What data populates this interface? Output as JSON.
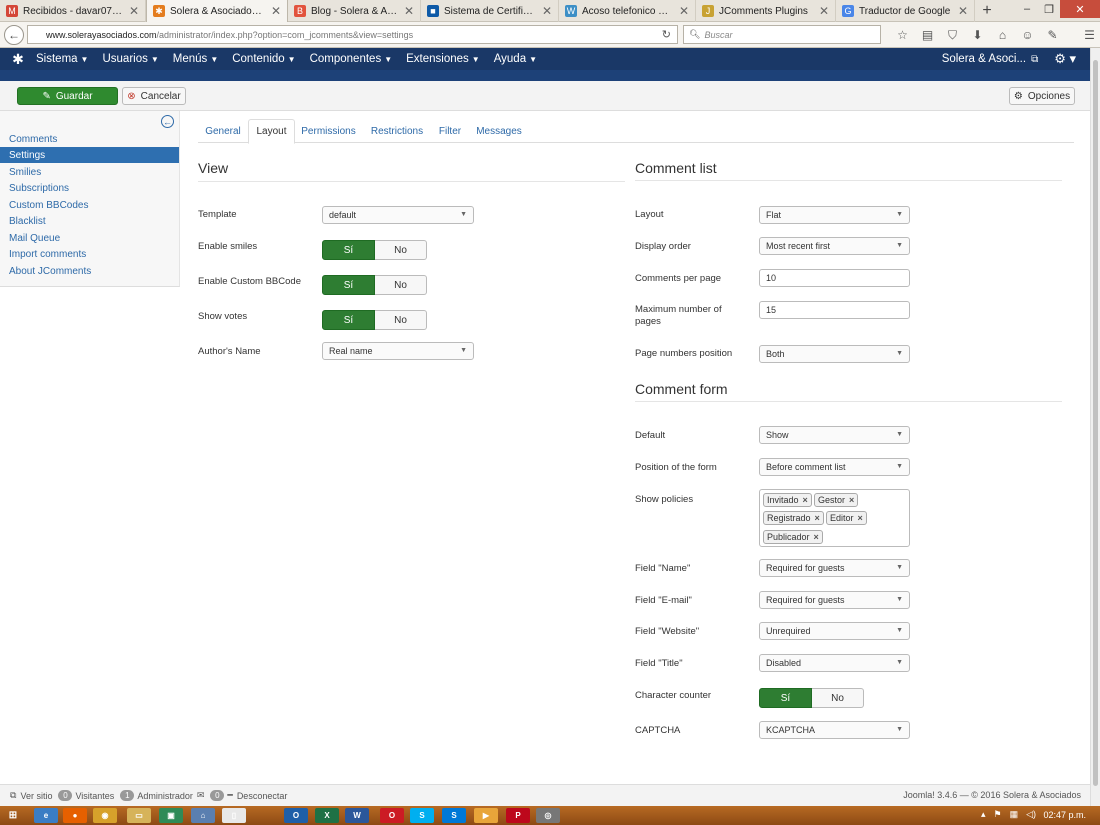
{
  "browser": {
    "tabs": [
      {
        "label": "Recibidos - davar07@g...",
        "icon": "gmail-icon",
        "color": "#d44638",
        "glyph": "M"
      },
      {
        "label": "Solera & Asociados - Ad...",
        "icon": "joomla-icon",
        "color": "#e47d1f",
        "glyph": "✱"
      },
      {
        "label": "Blog - Solera & Asociados",
        "icon": "blogger-icon",
        "color": "#e2533d",
        "glyph": "B"
      },
      {
        "label": "Sistema de Certificacion...",
        "icon": "certificate-icon",
        "color": "#0e5aa7",
        "glyph": "■"
      },
      {
        "label": "Acoso telefonico por de...",
        "icon": "wordpress-icon",
        "color": "#3d8fc6",
        "glyph": "W"
      },
      {
        "label": "JComments Plugins",
        "icon": "jcomments-icon",
        "color": "#c8a233",
        "glyph": "J"
      },
      {
        "label": "Traductor de Google",
        "icon": "translate-icon",
        "color": "#4a86e8",
        "glyph": "G"
      }
    ],
    "new_tab": "+",
    "url_host": "www.solerayasociados.com",
    "url_path": "/administrator/index.php?option=com_jcomments&view=settings",
    "search_placeholder": "Buscar"
  },
  "admin_menu": {
    "items": [
      "Sistema",
      "Usuarios",
      "Menús",
      "Contenido",
      "Componentes",
      "Extensiones",
      "Ayuda"
    ],
    "site_name": "Solera & Asoci..."
  },
  "toolbar": {
    "save_label": "Guardar",
    "cancel_label": "Cancelar",
    "options_label": "Opciones"
  },
  "sidebar": {
    "items": [
      {
        "label": "Comments",
        "active": false
      },
      {
        "label": "Settings",
        "active": true
      },
      {
        "label": "Smilies",
        "active": false
      },
      {
        "label": "Subscriptions",
        "active": false
      },
      {
        "label": "Custom BBCodes",
        "active": false
      },
      {
        "label": "Blacklist",
        "active": false
      },
      {
        "label": "Mail Queue",
        "active": false
      },
      {
        "label": "Import comments",
        "active": false
      },
      {
        "label": "About JComments",
        "active": false
      }
    ]
  },
  "tabs": [
    "General",
    "Layout",
    "Permissions",
    "Restrictions",
    "Filter",
    "Messages"
  ],
  "active_tab": "Layout",
  "view": {
    "title": "View",
    "template_label": "Template",
    "template_value": "default",
    "smiles_label": "Enable smiles",
    "bbcode_label": "Enable Custom BBCode",
    "votes_label": "Show votes",
    "author_label": "Author's Name",
    "author_value": "Real name",
    "yes": "Sí",
    "no": "No"
  },
  "comment_list": {
    "title": "Comment list",
    "layout_label": "Layout",
    "layout_value": "Flat",
    "order_label": "Display order",
    "order_value": "Most recent first",
    "per_page_label": "Comments per page",
    "per_page_value": "10",
    "max_pages_label": "Maximum number of pages",
    "max_pages_value": "15",
    "page_numbers_label": "Page numbers position",
    "page_numbers_value": "Both"
  },
  "comment_form": {
    "title": "Comment form",
    "default_label": "Default",
    "default_value": "Show",
    "position_label": "Position of the form",
    "position_value": "Before comment list",
    "policies_label": "Show policies",
    "policies": [
      "Invitado",
      "Gestor",
      "Registrado",
      "Editor",
      "Publicador"
    ],
    "name_label": "Field \"Name\"",
    "name_value": "Required for guests",
    "email_label": "Field \"E-mail\"",
    "email_value": "Required for guests",
    "website_label": "Field \"Website\"",
    "website_value": "Unrequired",
    "title_label": "Field \"Title\"",
    "title_value": "Disabled",
    "counter_label": "Character counter",
    "captcha_label": "CAPTCHA",
    "captcha_value": "KCAPTCHA",
    "yes": "Sí",
    "no": "No"
  },
  "status": {
    "view_site": "Ver sitio",
    "visitors_count": "0",
    "visitors_label": "Visitantes",
    "admins_count": "1",
    "admins_label": "Administrador",
    "messages_count": "0",
    "logout": "Desconectar",
    "version": "Joomla! 3.4.6 — © 2016 Solera & Asociados"
  },
  "taskbar": {
    "apps": [
      {
        "icon": "ie-icon",
        "color": "#3b7dc4",
        "glyph": "e"
      },
      {
        "icon": "firefox-icon",
        "color": "#e66000",
        "glyph": "●"
      },
      {
        "icon": "chrome-icon",
        "color": "#d7a12b",
        "glyph": "◉"
      },
      {
        "icon": "explorer-icon",
        "color": "#d6b35a",
        "glyph": "▭"
      },
      {
        "icon": "store-icon",
        "color": "#2e8b57",
        "glyph": "▣"
      },
      {
        "icon": "home-icon",
        "color": "#5a7fb0",
        "glyph": "⌂"
      },
      {
        "icon": "notepad-icon",
        "color": "#e8e8e8",
        "glyph": "▯"
      },
      {
        "icon": "outlook-icon",
        "color": "#1e5fa8",
        "glyph": "O"
      },
      {
        "icon": "excel-icon",
        "color": "#1e7145",
        "glyph": "X"
      },
      {
        "icon": "word-icon",
        "color": "#2b579a",
        "glyph": "W"
      },
      {
        "icon": "opera-icon",
        "color": "#cc1b24",
        "glyph": "O"
      },
      {
        "icon": "skype-icon",
        "color": "#00aff0",
        "glyph": "S"
      },
      {
        "icon": "skype2-icon",
        "color": "#0078d7",
        "glyph": "S"
      },
      {
        "icon": "media-icon",
        "color": "#e8a53a",
        "glyph": "▶"
      },
      {
        "icon": "pinterest-icon",
        "color": "#bd081c",
        "glyph": "P"
      },
      {
        "icon": "camera-icon",
        "color": "#777777",
        "glyph": "◎"
      }
    ],
    "clock": "02:47 p.m."
  }
}
